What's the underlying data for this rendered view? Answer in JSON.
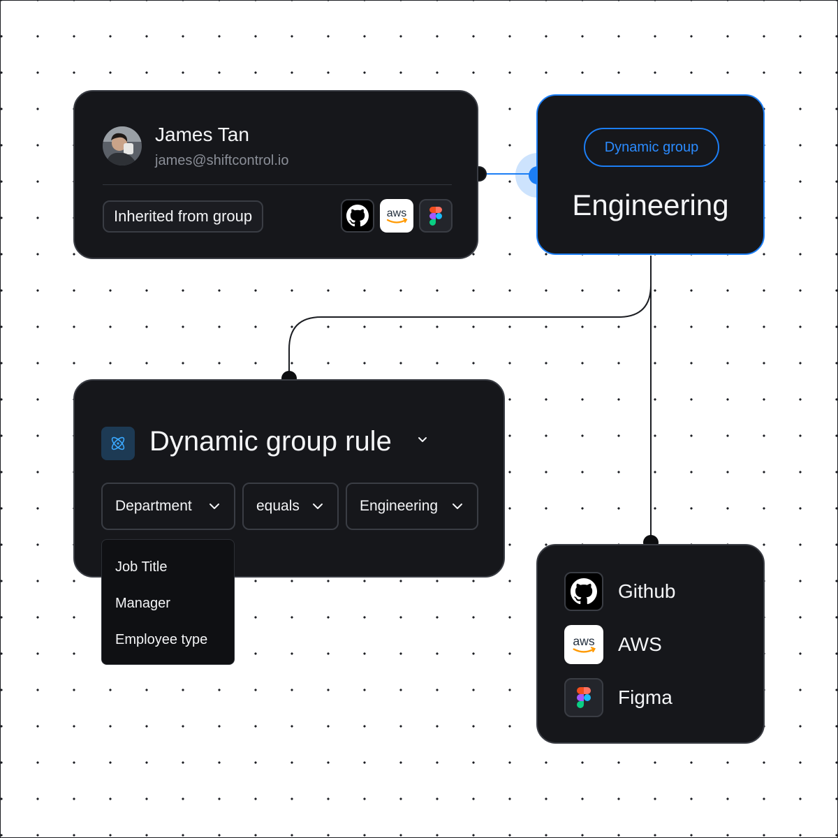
{
  "user": {
    "name": "James Tan",
    "email": "james@shiftcontrol.io",
    "inherited_label": "Inherited from group",
    "apps": [
      "github-icon",
      "aws-icon",
      "figma-icon"
    ]
  },
  "group": {
    "badge": "Dynamic group",
    "name": "Engineering"
  },
  "rule": {
    "title": "Dynamic group rule",
    "field_value": "Department",
    "operator_value": "equals",
    "target_value": "Engineering",
    "dropdown_options": [
      "Job Title",
      "Manager",
      "Employee type"
    ]
  },
  "apps": [
    {
      "label": "Github",
      "icon": "github-icon"
    },
    {
      "label": "AWS",
      "icon": "aws-icon"
    },
    {
      "label": "Figma",
      "icon": "figma-icon"
    }
  ],
  "icons": {
    "aws_text": "aws"
  },
  "colors": {
    "accent": "#1c7ef5",
    "card": "#16171b",
    "border": "#3a3d44",
    "text": "#f4f5f7",
    "muted": "#8a8e97"
  }
}
